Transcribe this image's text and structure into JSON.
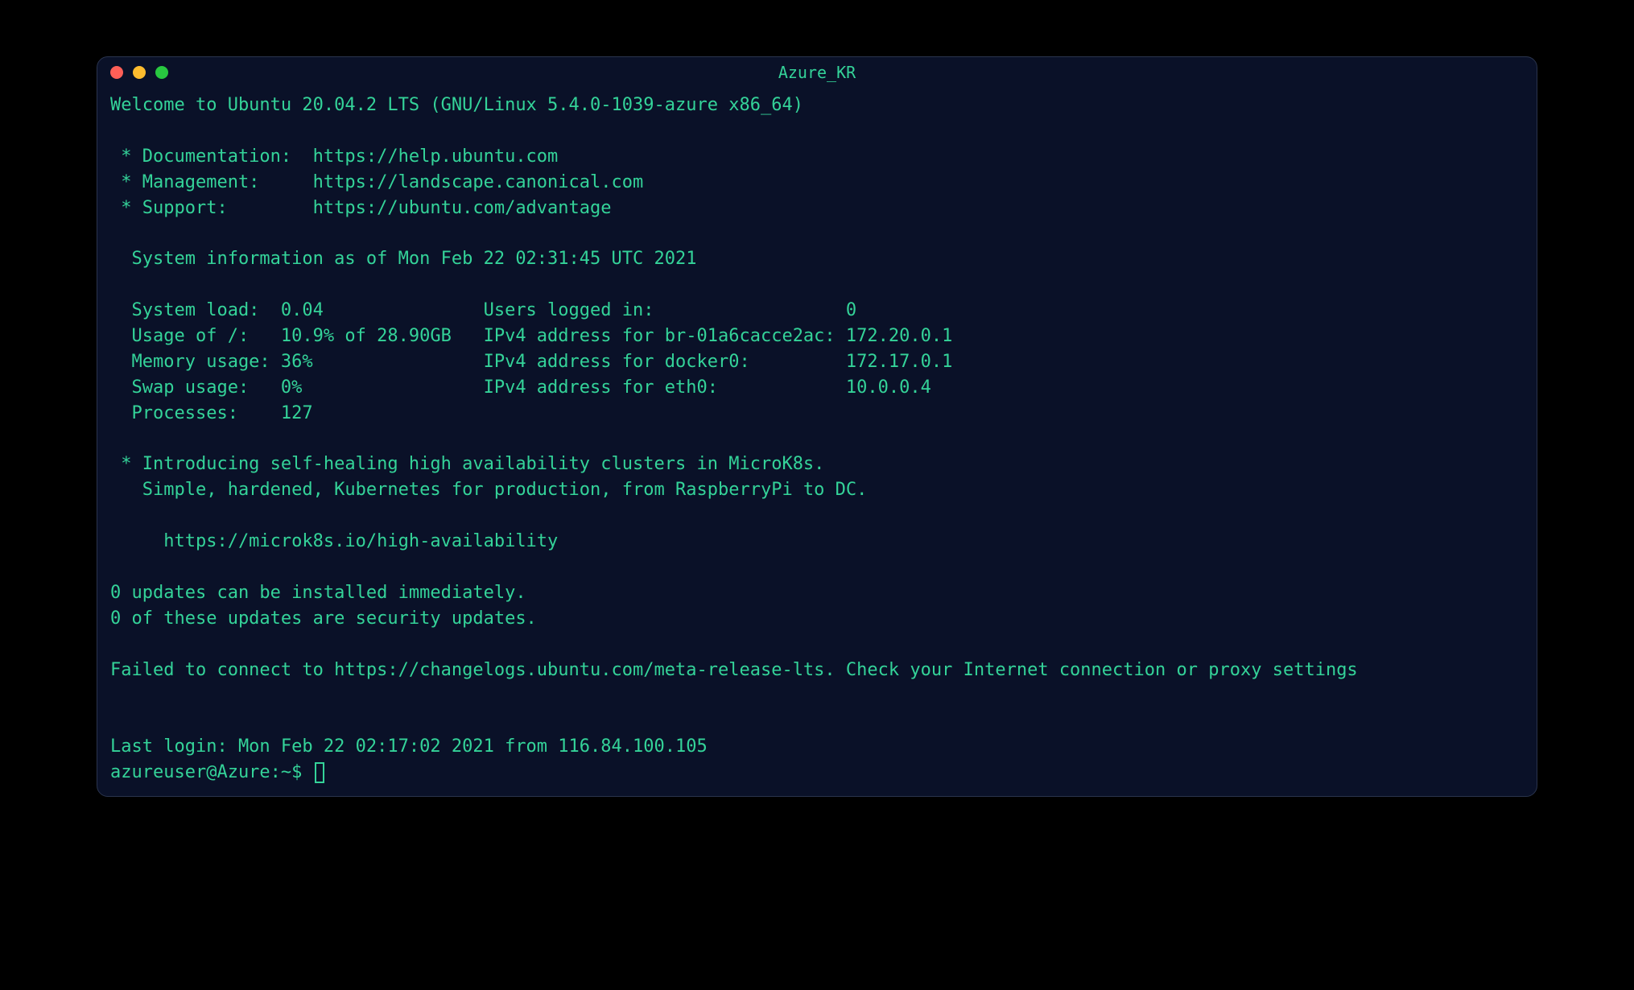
{
  "window": {
    "title": "Azure_KR"
  },
  "motd": {
    "welcome": "Welcome to Ubuntu 20.04.2 LTS (GNU/Linux 5.4.0-1039-azure x86_64)",
    "doc_line": " * Documentation:  https://help.ubuntu.com",
    "mgmt_line": " * Management:     https://landscape.canonical.com",
    "support_line": " * Support:        https://ubuntu.com/advantage",
    "sysinfo_header": "  System information as of Mon Feb 22 02:31:45 UTC 2021",
    "row1": "  System load:  0.04               Users logged in:                  0",
    "row2": "  Usage of /:   10.9% of 28.90GB   IPv4 address for br-01a6cacce2ac: 172.20.0.1",
    "row3": "  Memory usage: 36%                IPv4 address for docker0:         172.17.0.1",
    "row4": "  Swap usage:   0%                 IPv4 address for eth0:            10.0.0.4",
    "row5": "  Processes:    127",
    "microk8s1": " * Introducing self-healing high availability clusters in MicroK8s.",
    "microk8s2": "   Simple, hardened, Kubernetes for production, from RaspberryPi to DC.",
    "microk8s3": "     https://microk8s.io/high-availability",
    "updates1": "0 updates can be installed immediately.",
    "updates2": "0 of these updates are security updates.",
    "fail": "Failed to connect to https://changelogs.ubuntu.com/meta-release-lts. Check your Internet connection or proxy settings",
    "lastlogin": "Last login: Mon Feb 22 02:17:02 2021 from 116.84.100.105"
  },
  "prompt": {
    "text": "azureuser@Azure:~$ "
  }
}
